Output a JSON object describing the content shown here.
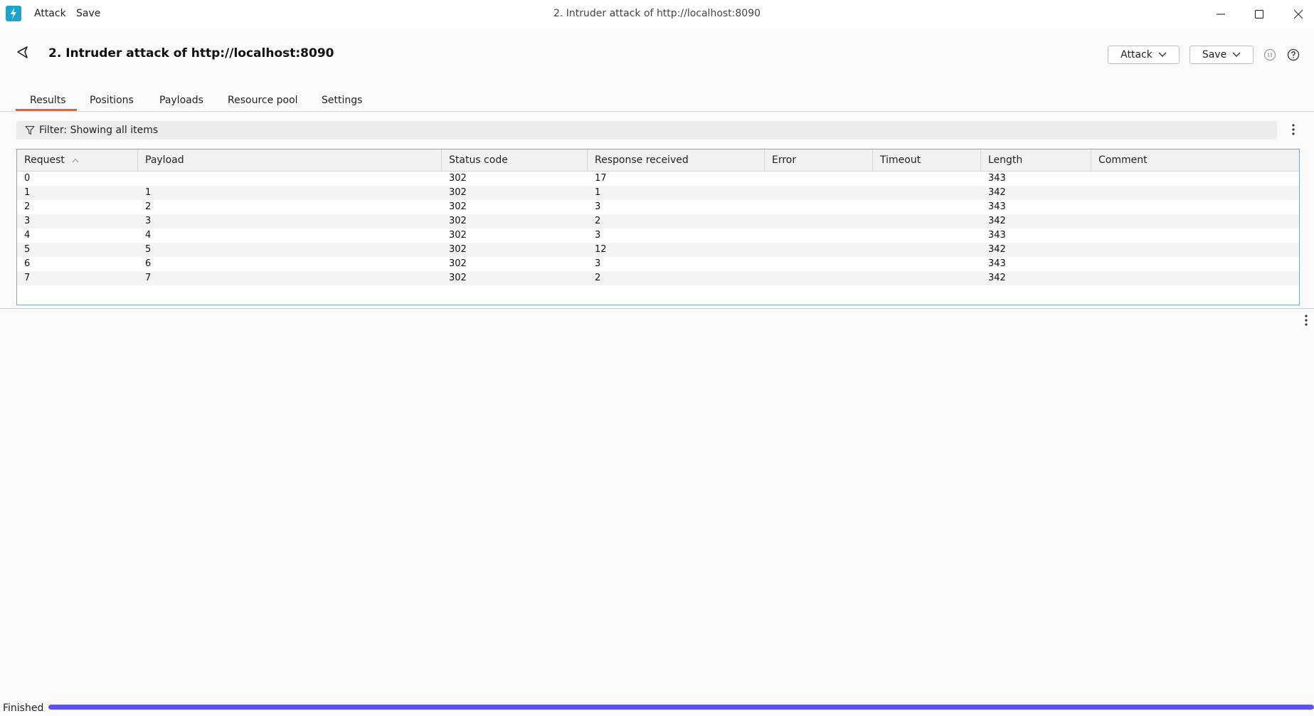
{
  "titlebar": {
    "menu": [
      "Attack",
      "Save"
    ],
    "window_title": "2. Intruder attack of http://localhost:8090"
  },
  "header": {
    "title": "2. Intruder attack of http://localhost:8090",
    "attack_label": "Attack",
    "save_label": "Save"
  },
  "tabs": [
    {
      "label": "Results",
      "active": true
    },
    {
      "label": "Positions",
      "active": false
    },
    {
      "label": "Payloads",
      "active": false
    },
    {
      "label": "Resource pool",
      "active": false
    },
    {
      "label": "Settings",
      "active": false
    }
  ],
  "filter": {
    "text": "Filter: Showing all items"
  },
  "table": {
    "columns": [
      "Request",
      "Payload",
      "Status code",
      "Response received",
      "Error",
      "Timeout",
      "Length",
      "Comment"
    ],
    "sorted_column": "Request",
    "rows": [
      [
        "0",
        "",
        "302",
        "17",
        "",
        "",
        "343",
        ""
      ],
      [
        "1",
        "1",
        "302",
        "1",
        "",
        "",
        "342",
        ""
      ],
      [
        "2",
        "2",
        "302",
        "3",
        "",
        "",
        "343",
        ""
      ],
      [
        "3",
        "3",
        "302",
        "2",
        "",
        "",
        "342",
        ""
      ],
      [
        "4",
        "4",
        "302",
        "3",
        "",
        "",
        "343",
        ""
      ],
      [
        "5",
        "5",
        "302",
        "12",
        "",
        "",
        "342",
        ""
      ],
      [
        "6",
        "6",
        "302",
        "3",
        "",
        "",
        "343",
        ""
      ],
      [
        "7",
        "7",
        "302",
        "2",
        "",
        "",
        "342",
        ""
      ]
    ]
  },
  "status": {
    "text": "Finished",
    "progress_percent": 100
  },
  "colors": {
    "accent_tab": "#e8612c",
    "progress": "#5b52e6",
    "logo": "#1fa3c8"
  },
  "icons": [
    "burp-logo-icon",
    "minimize-icon",
    "maximize-icon",
    "close-icon",
    "back-icon",
    "chevron-down-icon",
    "pause-icon",
    "help-icon",
    "filter-icon",
    "kebab-menu-icon",
    "sort-ascending-icon"
  ]
}
